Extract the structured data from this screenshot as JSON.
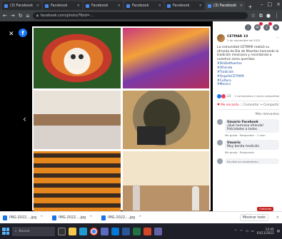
{
  "browser": {
    "tabs": [
      {
        "title": "(3) Facebook"
      },
      {
        "title": "Facebook"
      },
      {
        "title": "Facebook"
      },
      {
        "title": "Facebook"
      },
      {
        "title": "Facebook"
      },
      {
        "title": "(3) Facebook"
      }
    ],
    "url": "facebook.com/photo/?fbid=..."
  },
  "post": {
    "author": "CETMAR 10",
    "date": "2 de noviembre de 2022",
    "text": "La comunidad CETMAR realizó su ofrenda de Día de Muertos honrando la tradición mexicana y recordando a nuestros seres queridos.",
    "hashtags": [
      "#DíaDeMuertos",
      "#Ofrenda",
      "#Tradición",
      "#OrgulloCETMAR",
      "#Cultura",
      "#Mexico"
    ],
    "reaction_count": "23",
    "comments_shares": "2 comentarios  4 veces compartido",
    "actions": {
      "like": "Me encanta",
      "comment": "Comentar",
      "share": "Compartir"
    },
    "relevant": "Más relevantes",
    "comments": [
      {
        "name": "Usuario Facebook",
        "text": "¡Qué hermosa ofrenda! Felicidades a todos.",
        "meta": "Me gusta · Responder · 1 sem"
      },
      {
        "name": "Usuario",
        "text": "Muy bonita tradición",
        "meta": "Me gusta · Responder"
      }
    ],
    "write_placeholder": "Escribe un comentario..."
  },
  "downloads": [
    {
      "name": "IMG-2022....jpg"
    },
    {
      "name": "IMG-2022....jpg"
    },
    {
      "name": "IMG-2022....jpg"
    }
  ],
  "downloads_show_all": "Mostrar todo",
  "recording": "Grabando",
  "taskbar": {
    "search": "Buscar",
    "time": "12:45",
    "date": "03/11/2022"
  }
}
